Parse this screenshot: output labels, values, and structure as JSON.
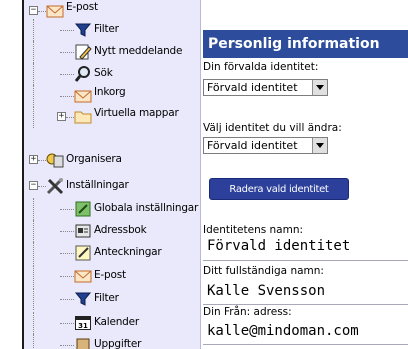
{
  "sidebar": {
    "items": [
      {
        "label": "E-post"
      },
      {
        "label": "Filter"
      },
      {
        "label": "Nytt meddelande"
      },
      {
        "label": "Sök"
      },
      {
        "label": "Inkorg"
      },
      {
        "label": "Virtuella mappar"
      },
      {
        "label": "Organisera"
      },
      {
        "label": "Inställningar"
      },
      {
        "label": "Globala inställningar"
      },
      {
        "label": "Adressbok"
      },
      {
        "label": "Anteckningar"
      },
      {
        "label": "E-post"
      },
      {
        "label": "Filter"
      },
      {
        "label": "Kalender"
      },
      {
        "label": "Uppgifter"
      }
    ],
    "calendar_icon_text": "31"
  },
  "panel": {
    "title": "Personlig information",
    "default_identity_label": "Din förvalda identitet:",
    "default_identity_value": "Förvald identitet",
    "edit_identity_label": "Välj identitet du vill ändra:",
    "edit_identity_value": "Förvald identitet",
    "delete_button": "Radera vald identitet",
    "identity_name_label": "Identitetens namn:",
    "identity_name_value": "Förvald identitet",
    "full_name_label": "Ditt fullständiga namn:",
    "full_name_value": "Kalle Svensson",
    "from_address_label": "Din Från: adress:",
    "from_address_value": "kalle@mindoman.com"
  },
  "colors": {
    "header_bg": "#2d4d9c",
    "sidebar_bg": "#e9e9fb",
    "button_bg": "#2c3f9b"
  }
}
